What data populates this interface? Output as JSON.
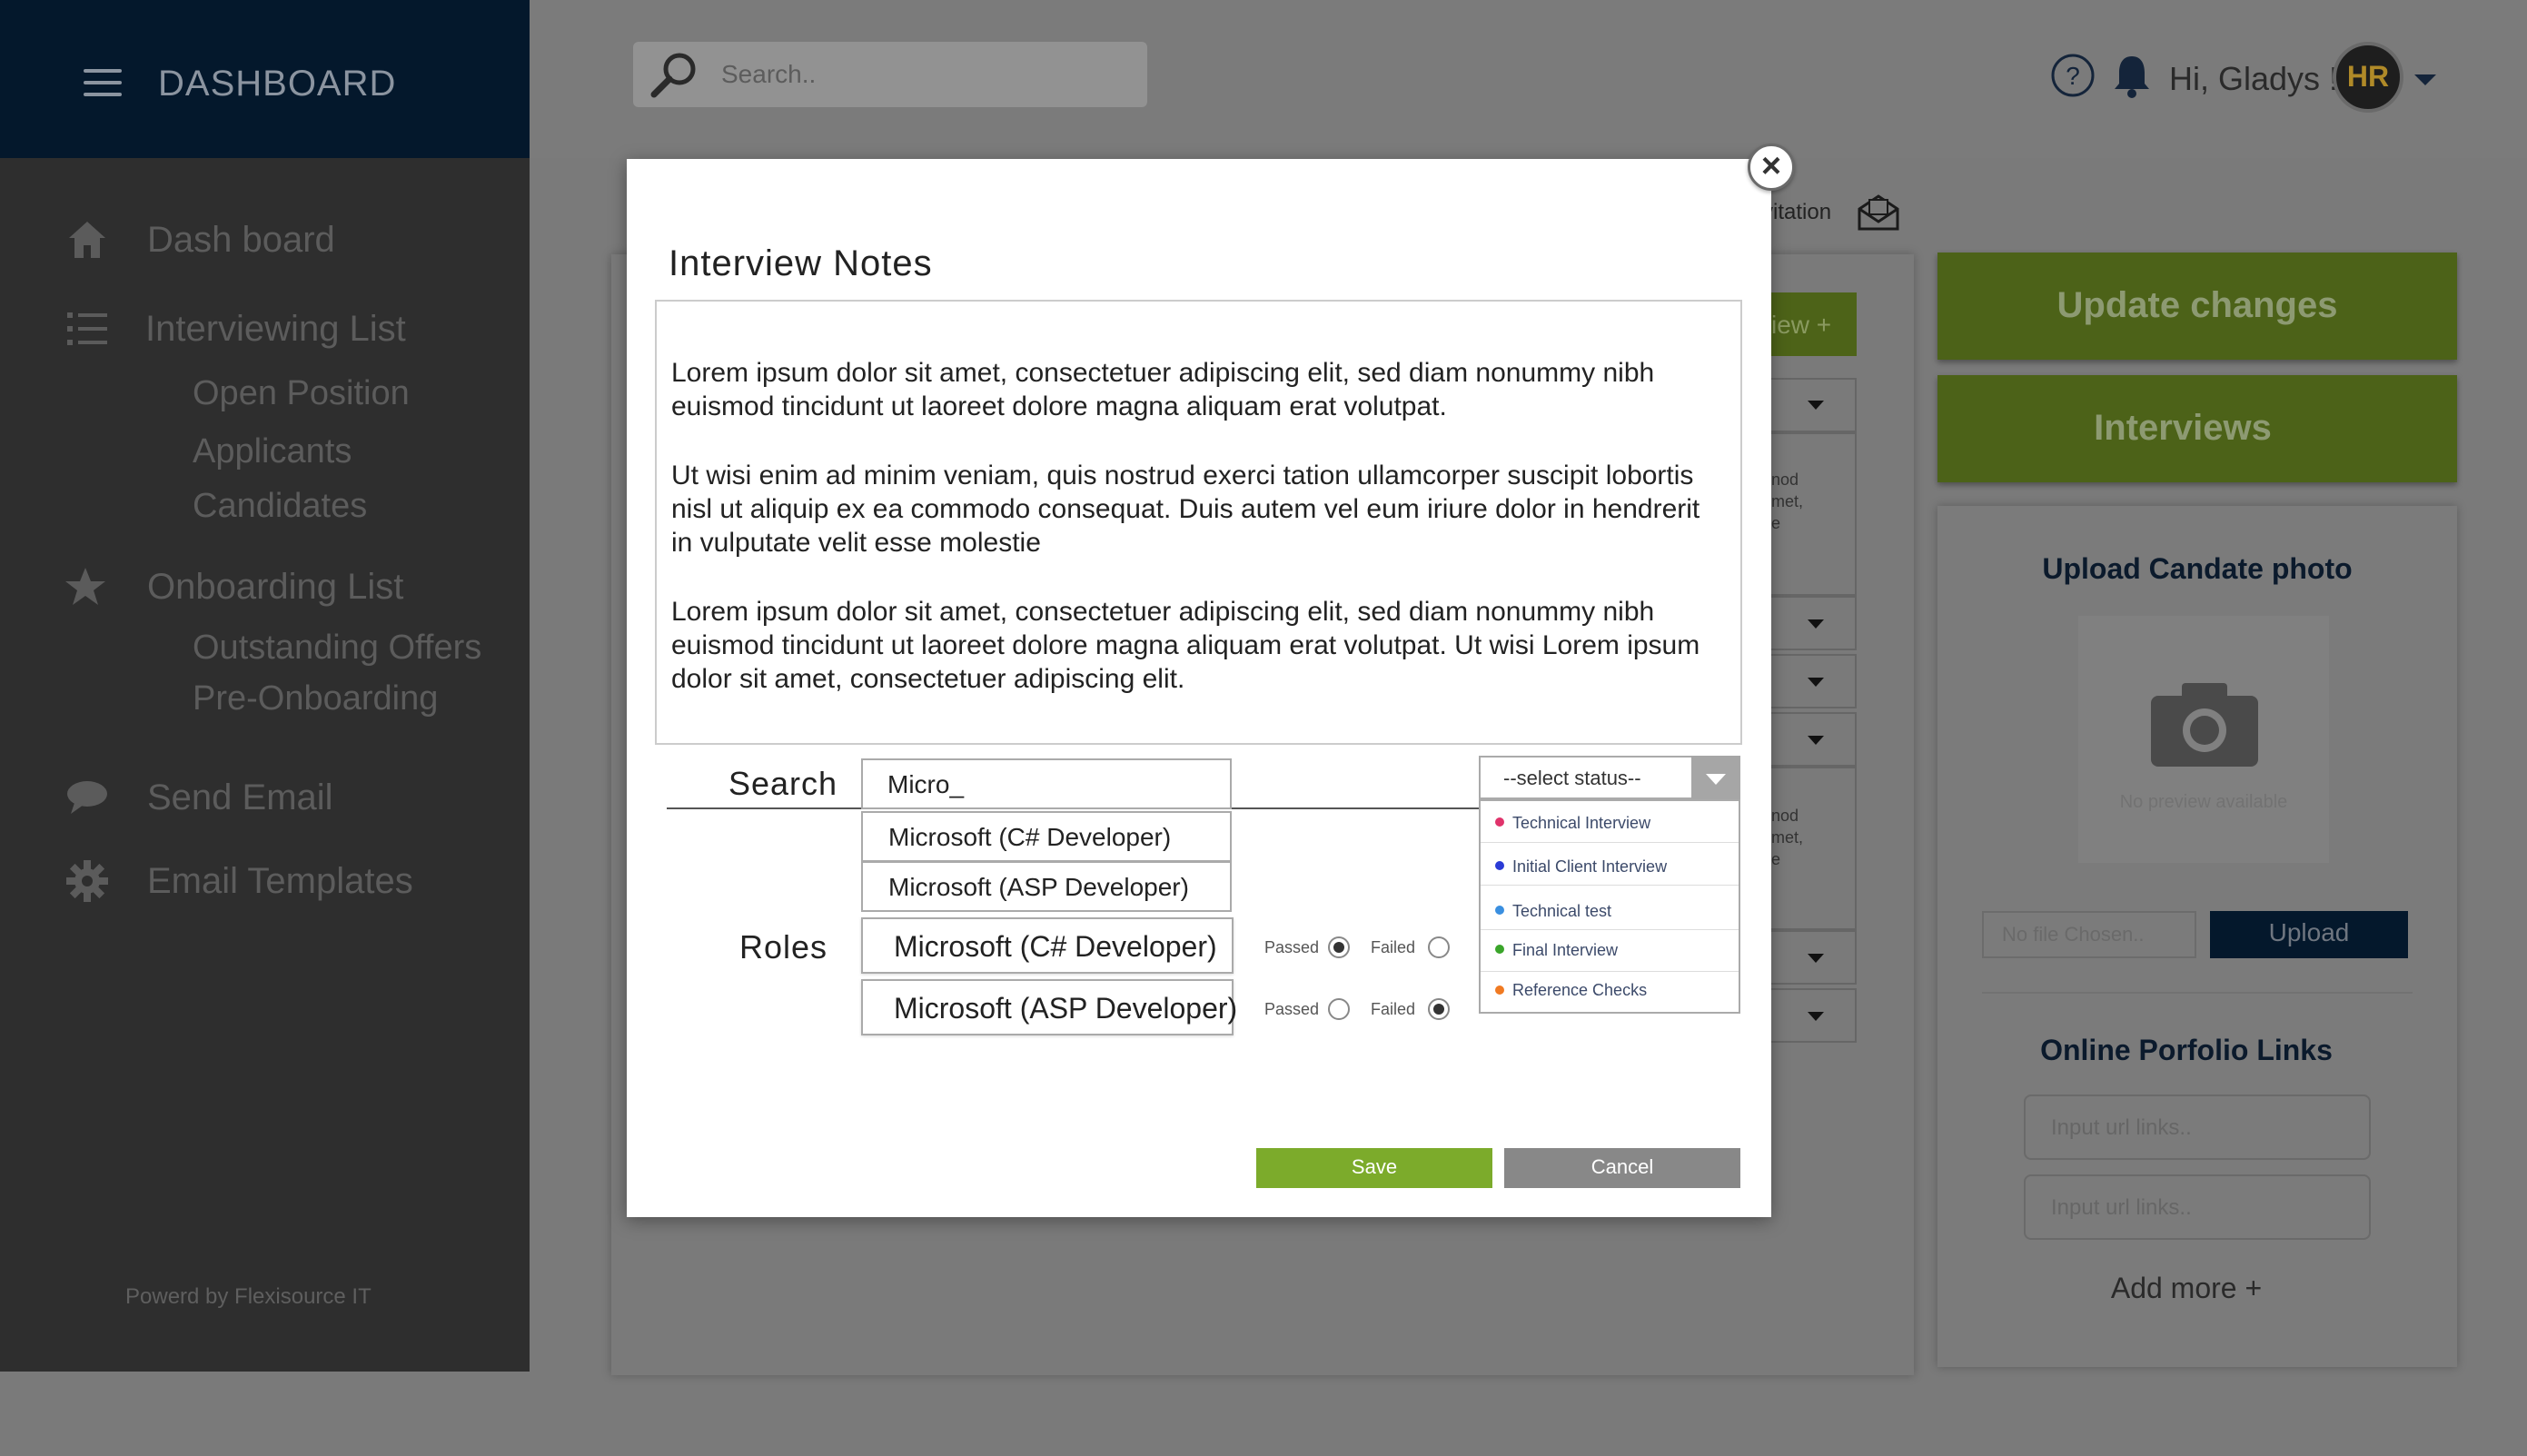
{
  "sidebar": {
    "title": "DASHBOARD",
    "items": [
      {
        "label": "Dash board",
        "icon": "home-icon"
      },
      {
        "label": "Interviewing List",
        "icon": "list-icon",
        "subitems": [
          "Open Position",
          "Applicants",
          "Candidates"
        ]
      },
      {
        "label": "Onboarding List",
        "icon": "star-icon",
        "subitems": [
          "Outstanding Offers",
          "Pre-Onboarding"
        ]
      },
      {
        "label": "Send Email",
        "icon": "chat-bubble-icon"
      },
      {
        "label": "Email Templates",
        "icon": "gear-icon"
      }
    ],
    "powered_by": "Powerd by Flexisource IT"
  },
  "header": {
    "search_placeholder": "Search..",
    "greeting": "Hi, Gladys !",
    "avatar_text": "HR"
  },
  "background": {
    "invitation_label": "vitation",
    "green_button_fragment": "iew +",
    "text_fragment_1": "nod\nmet,\ne",
    "text_fragment_2": "nod\nmet,\ne",
    "update_changes": "Update changes",
    "interviews": "Interviews",
    "upload_title": "Upload Candate photo",
    "no_preview": "No preview available",
    "no_file": "No file Chosen..",
    "upload_button": "Upload",
    "portfolio_title": "Online Porfolio Links",
    "url_placeholder_1": "Input url links..",
    "url_placeholder_2": "Input url links..",
    "add_more": "Add more +"
  },
  "modal": {
    "title": "Interview Notes",
    "paragraphs": [
      "Lorem ipsum dolor sit amet, consectetuer adipiscing elit, sed diam nonummy nibh euismod tincidunt ut laoreet dolore magna aliquam erat volutpat.",
      "Ut wisi enim ad minim veniam, quis nostrud exerci tation ullamcorper suscipit lobortis nisl ut aliquip ex ea commodo consequat. Duis autem vel eum iriure dolor in hendrerit in vulputate velit esse molestie",
      "Lorem ipsum dolor sit amet, consectetuer adipiscing elit, sed diam nonummy nibh euismod tincidunt ut laoreet dolore magna aliquam erat volutpat. Ut wisi Lorem ipsum dolor sit amet, consectetuer adipiscing elit."
    ],
    "search_label": "Search",
    "search_value": "Micro_",
    "suggestions": [
      "Microsoft (C# Developer)",
      "Microsoft (ASP Developer)"
    ],
    "roles_label": "Roles",
    "roles": [
      {
        "label": "Microsoft (C# Developer)",
        "passed_label": "Passed",
        "failed_label": "Failed",
        "result": "passed"
      },
      {
        "label": "Microsoft (ASP Developer)",
        "passed_label": "Passed",
        "failed_label": "Failed",
        "result": "failed"
      }
    ],
    "status_placeholder": "--select status--",
    "status_options": [
      {
        "label": "Technical Interview",
        "color": "#e0336b"
      },
      {
        "label": "Initial Client Interview",
        "color": "#2a3bd6"
      },
      {
        "label": "Technical test",
        "color": "#3a8fe0"
      },
      {
        "label": "Final Interview",
        "color": "#3aa52a"
      },
      {
        "label": "Reference Checks",
        "color": "#f07a22"
      }
    ],
    "save": "Save",
    "cancel": "Cancel"
  },
  "colors": {
    "sidebar_dark": "#04182c",
    "accent_green": "#7cab2b",
    "overlay_green": "#4c6218"
  }
}
